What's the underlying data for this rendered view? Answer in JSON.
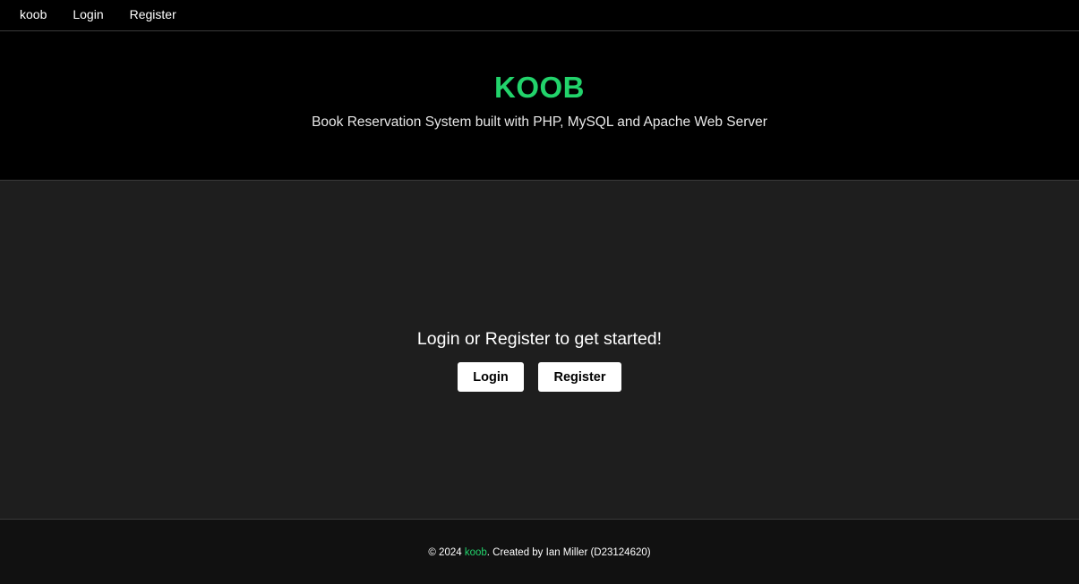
{
  "colors": {
    "accent": "#22d36b",
    "header_bg": "#000000",
    "main_bg": "#1e1e1e",
    "footer_bg": "#111111",
    "button_bg": "#ffffff",
    "button_text": "#000000"
  },
  "nav": {
    "items": [
      {
        "label": "koob"
      },
      {
        "label": "Login"
      },
      {
        "label": "Register"
      }
    ]
  },
  "hero": {
    "title": "KOOB",
    "subtitle": "Book Reservation System built with PHP, MySQL and Apache Web Server"
  },
  "main": {
    "cta_text": "Login or Register to get started!",
    "login_label": "Login",
    "register_label": "Register"
  },
  "footer": {
    "prefix": "© 2024 ",
    "brand": "koob",
    "suffix": ". Created by Ian Miller (D23124620)"
  }
}
